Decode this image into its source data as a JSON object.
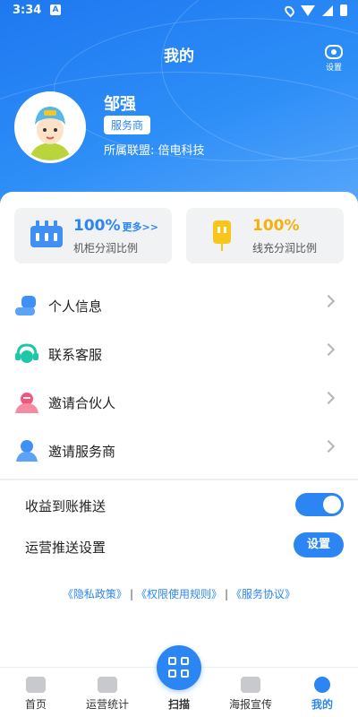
{
  "statusbar": {
    "time": "3:34",
    "app_badge": "A"
  },
  "header": {
    "title": "我的",
    "settings_label": "设置"
  },
  "profile": {
    "name": "邹强",
    "role": "服务商",
    "alliance": "所属联盟: 倍电科技"
  },
  "stats": [
    {
      "value": "100%",
      "more": "更多>>",
      "label": "机柜分润比例",
      "color": "#2b86f4"
    },
    {
      "value": "100%",
      "label": "线充分润比例",
      "color": "#f2b10c"
    }
  ],
  "menu": [
    {
      "label": "个人信息",
      "icon": "person-card-icon",
      "color": "#3f8ff5"
    },
    {
      "label": "联系客服",
      "icon": "headset-icon",
      "color": "#1ec7a8"
    },
    {
      "label": "邀请合伙人",
      "icon": "partner-icon",
      "color": "#f5557a"
    },
    {
      "label": "邀请服务商",
      "icon": "user-icon",
      "color": "#3f8ff5"
    }
  ],
  "settings": {
    "income_push_label": "收益到账推送",
    "income_push_on": true,
    "ops_push_label": "运营推送设置",
    "ops_push_button": "设置"
  },
  "links": {
    "privacy": "《隐私政策》",
    "permission": "《权限使用规则》",
    "service": "《服务协议》",
    "separator": "|"
  },
  "tabs": [
    {
      "label": "首页",
      "icon": "home-icon"
    },
    {
      "label": "运营统计",
      "icon": "chart-icon"
    },
    {
      "label": "扫描",
      "icon": "scan-icon"
    },
    {
      "label": "海报宣传",
      "icon": "poster-icon"
    },
    {
      "label": "我的",
      "icon": "profile-icon"
    }
  ],
  "colors": {
    "primary": "#2b86f4",
    "accent_yellow": "#f2b10c"
  }
}
